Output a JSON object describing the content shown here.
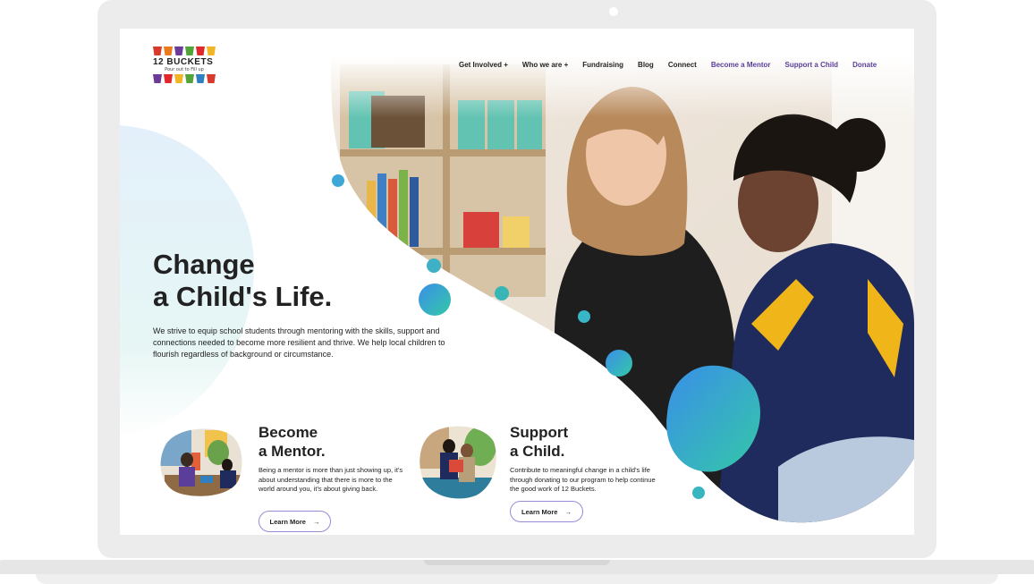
{
  "logo": {
    "name": "12 BUCKETS",
    "tagline": "Pour out to Fill up",
    "bucket_colors_top": [
      "#d63a2a",
      "#e97b1d",
      "#6a3b97",
      "#54a33a",
      "#e0272c",
      "#f2b526"
    ],
    "bucket_colors_bottom": [
      "#6a3b97",
      "#e0272c",
      "#f2b526",
      "#54a33a",
      "#2f7fc1",
      "#d63a2a"
    ]
  },
  "nav": {
    "items": [
      {
        "label": "Get Involved +"
      },
      {
        "label": "Who we are +"
      },
      {
        "label": "Fundraising"
      },
      {
        "label": "Blog"
      },
      {
        "label": "Connect"
      },
      {
        "label": "Become a Mentor"
      },
      {
        "label": "Support a Child"
      },
      {
        "label": "Donate"
      }
    ]
  },
  "hero": {
    "title_line1": "Change",
    "title_line2": "a Child's Life.",
    "description": "We strive to equip school students through mentoring with the skills, support and connections needed to become more resilient and thrive. We help local children to flourish regardless of background or circumstance."
  },
  "cards": {
    "mentor": {
      "title_line1": "Become",
      "title_line2": "a Mentor.",
      "description": "Being a mentor is more than just showing up, it's about understanding that there is more to the world around you, it's about giving back.",
      "button": "Learn More"
    },
    "support": {
      "title_line1": "Support",
      "title_line2": "a Child.",
      "description": "Contribute to meaningful change in a child's life through donating to our program to help continue the good work of 12 Buckets.",
      "button": "Learn More"
    }
  },
  "colors": {
    "accent_purple": "#5b3e9a",
    "gradient_blue": "#3a8ee8",
    "gradient_teal": "#34c8a8"
  }
}
